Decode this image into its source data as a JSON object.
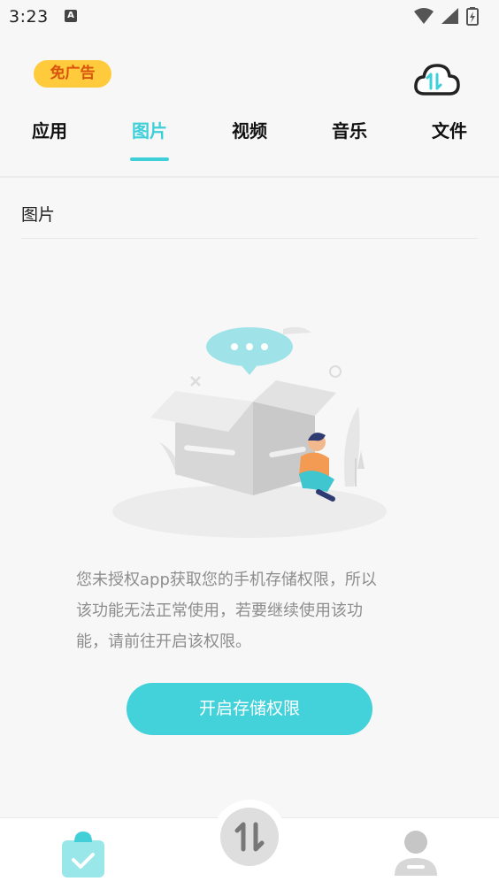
{
  "status_bar": {
    "time": "3:23",
    "notification_letter": "A",
    "icons": [
      "wifi-icon",
      "cell-signal-icon",
      "battery-charging-icon"
    ]
  },
  "header": {
    "ad_badge": "免广告",
    "cloud_icon": "cloud-transfer-icon",
    "accent_color": "#3ecfd9"
  },
  "tabs": [
    {
      "label": "应用",
      "active": false
    },
    {
      "label": "图片",
      "active": true
    },
    {
      "label": "视频",
      "active": false
    },
    {
      "label": "音乐",
      "active": false
    },
    {
      "label": "文件",
      "active": false
    }
  ],
  "content": {
    "section_title": "图片",
    "message_lines": [
      "您未授权app获取您的手机存储权限，所以",
      "该功能无法正常使用，若要继续使用该功",
      "能，请前往开启该权限。"
    ],
    "button_label": "开启存储权限"
  },
  "bottom_nav": {
    "items": [
      "clipboard-check-icon",
      "transfer-arrows-icon",
      "profile-icon"
    ]
  }
}
